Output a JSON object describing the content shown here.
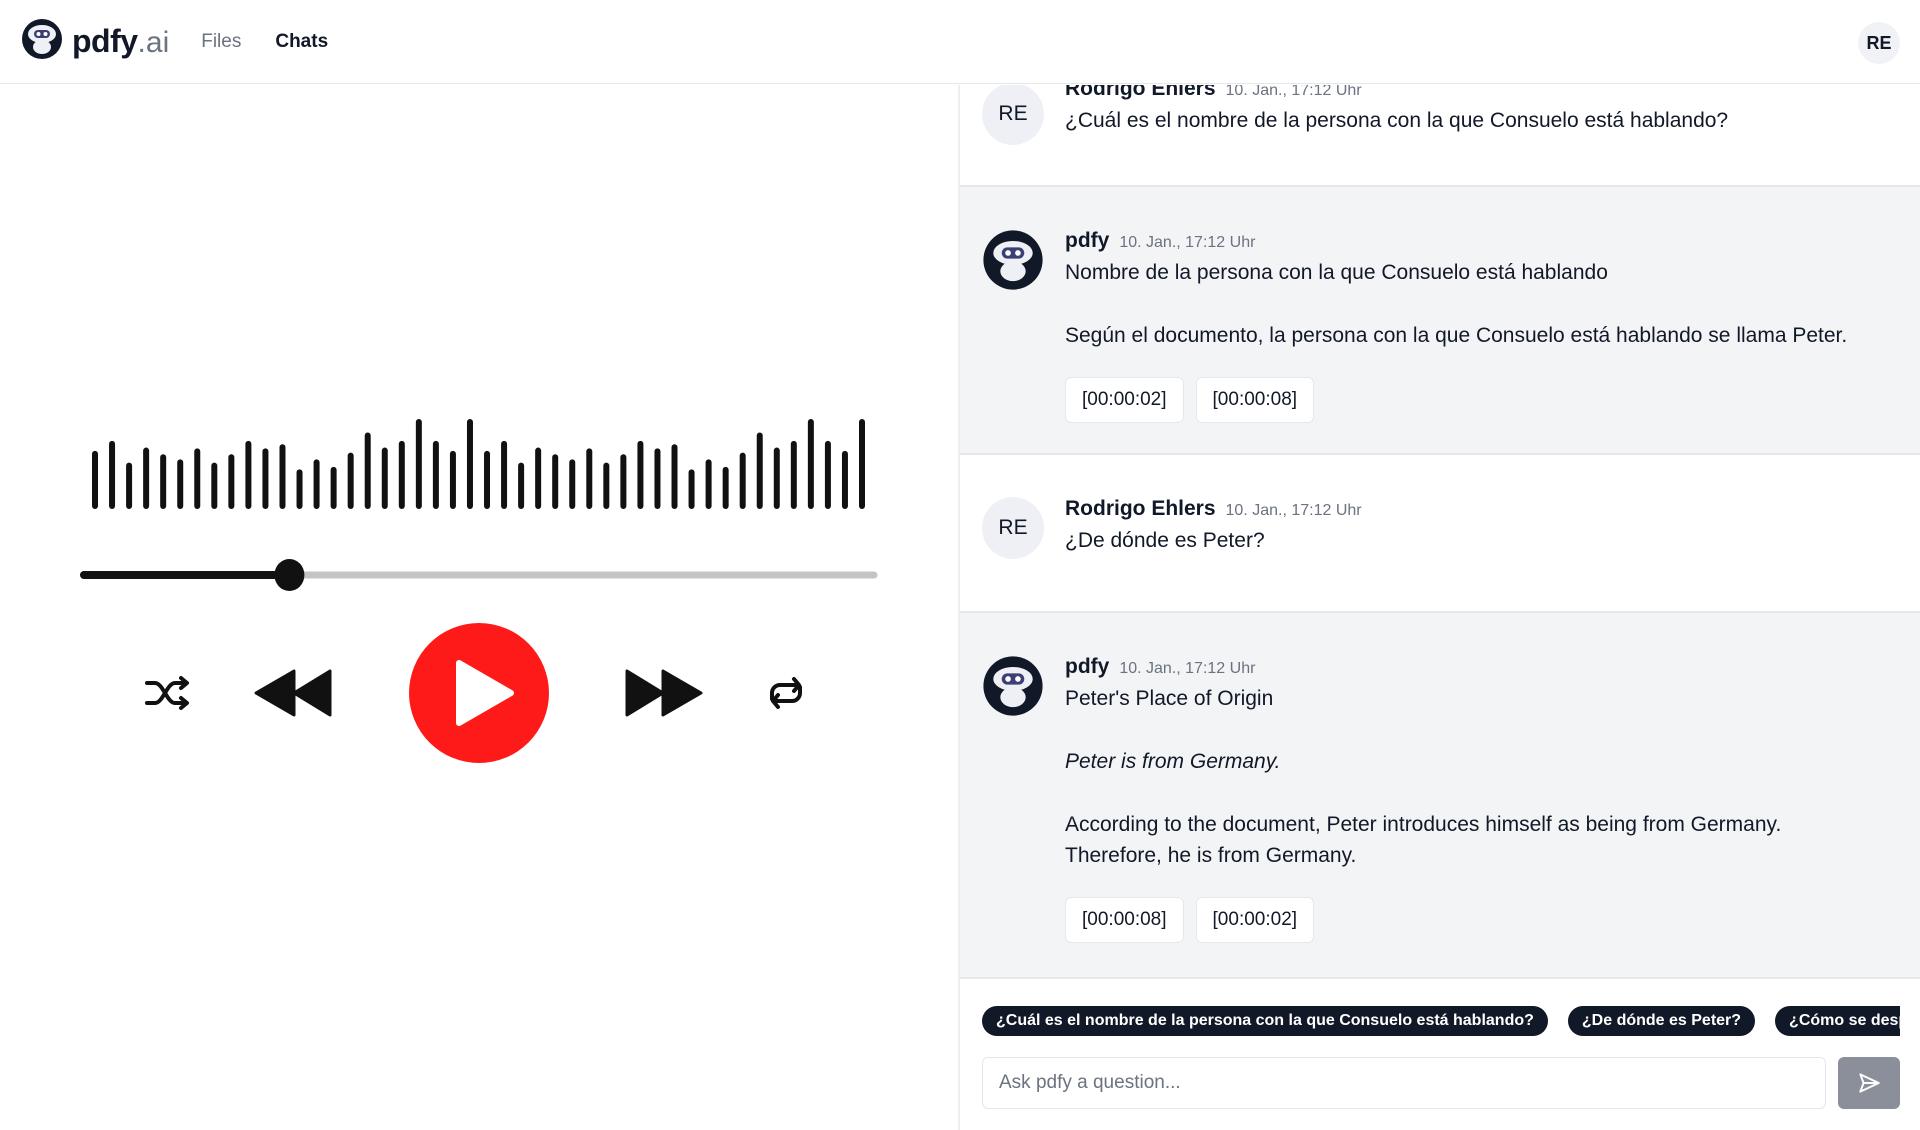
{
  "app": {
    "brand": "pdfy",
    "brand_suffix": ".ai",
    "nav": [
      {
        "label": "Files",
        "active": false
      },
      {
        "label": "Chats",
        "active": true
      }
    ],
    "user_initials": "RE"
  },
  "player": {
    "waveform_levels": [
      0.62,
      0.74,
      0.48,
      0.66,
      0.58,
      0.52,
      0.65,
      0.48,
      0.58,
      0.74,
      0.65,
      0.7,
      0.4,
      0.52,
      0.43,
      0.6,
      0.84,
      0.66,
      0.74,
      1.0,
      0.74,
      0.62,
      1.0,
      0.62,
      0.74,
      0.48,
      0.66,
      0.58,
      0.52,
      0.65,
      0.48,
      0.58,
      0.74,
      0.65,
      0.7,
      0.4,
      0.52,
      0.43,
      0.6,
      0.84,
      0.66,
      0.74,
      1.0,
      0.74,
      0.62,
      1.0
    ],
    "progress": 0.26,
    "colors": {
      "play": "#ff1a1a",
      "ink": "#111111",
      "track": "#c4c4c4"
    },
    "controls": [
      "shuffle",
      "rewind",
      "play",
      "fast-forward",
      "repeat"
    ]
  },
  "chat": {
    "messages": [
      {
        "role": "user",
        "author": "Rodrigo Ehlers",
        "initials": "RE",
        "time": "10. Jan., 17:12 Uhr",
        "text": "¿Cuál es el nombre de la persona con la que Consuelo está hablando?"
      },
      {
        "role": "bot",
        "author": "pdfy",
        "time": "10. Jan., 17:12 Uhr",
        "title": "Nombre de la persona con la que Consuelo está hablando",
        "paragraphs": [
          {
            "text": "Según el documento, la persona con la que Consuelo está hablando se llama Peter.",
            "italic": false
          }
        ],
        "refs": [
          "[00:00:02]",
          "[00:00:08]"
        ]
      },
      {
        "role": "user",
        "author": "Rodrigo Ehlers",
        "initials": "RE",
        "time": "10. Jan., 17:12 Uhr",
        "text": "¿De dónde es Peter?"
      },
      {
        "role": "bot",
        "author": "pdfy",
        "time": "10. Jan., 17:12 Uhr",
        "title": "Peter's Place of Origin",
        "paragraphs": [
          {
            "text": "Peter is from Germany.",
            "italic": true
          },
          {
            "text": "According to the document, Peter introduces himself as being from Germany. Therefore, he is from Germany.",
            "italic": false
          }
        ],
        "refs": [
          "[00:00:08]",
          "[00:00:02]"
        ]
      }
    ],
    "suggestions": [
      "¿Cuál es el nombre de la persona con la que Consuelo está hablando?",
      "¿De dónde es Peter?",
      "¿Cómo se despide Consuelo?"
    ],
    "input": {
      "placeholder": "Ask pdfy a question...",
      "value": ""
    }
  }
}
